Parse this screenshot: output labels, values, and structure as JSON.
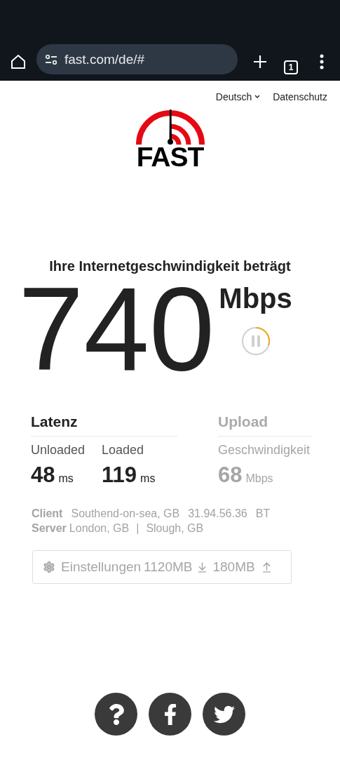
{
  "browser": {
    "url": "fast.com/de/#",
    "tab_count": "1"
  },
  "nav": {
    "language": "Deutsch",
    "privacy": "Datenschutz"
  },
  "logo_text": "FAST",
  "heading": "Ihre Internetgeschwindigkeit beträgt",
  "speed": {
    "value": "740",
    "unit": "Mbps"
  },
  "sections": [
    {
      "title": "Latenz",
      "active": true,
      "metrics": [
        {
          "label": "Unloaded",
          "value": "48",
          "unit": "ms"
        },
        {
          "label": "Loaded",
          "value": "119",
          "unit": "ms"
        }
      ]
    },
    {
      "title": "Upload",
      "active": false,
      "metrics": [
        {
          "label": "Geschwindigkeit",
          "value": "68",
          "unit": "Mbps"
        }
      ]
    }
  ],
  "client": {
    "label": "Client",
    "location": "Southend-on-sea, GB",
    "ip": "31.94.56.36",
    "isp": "BT"
  },
  "server": {
    "label": "Server",
    "locations": [
      "London, GB",
      "Slough, GB"
    ],
    "separator": "|"
  },
  "settings": {
    "label": "Einstellungen",
    "download": "1120MB",
    "upload": "180MB"
  },
  "footer": [
    {
      "kind": "help"
    },
    {
      "kind": "facebook"
    },
    {
      "kind": "twitter"
    }
  ]
}
